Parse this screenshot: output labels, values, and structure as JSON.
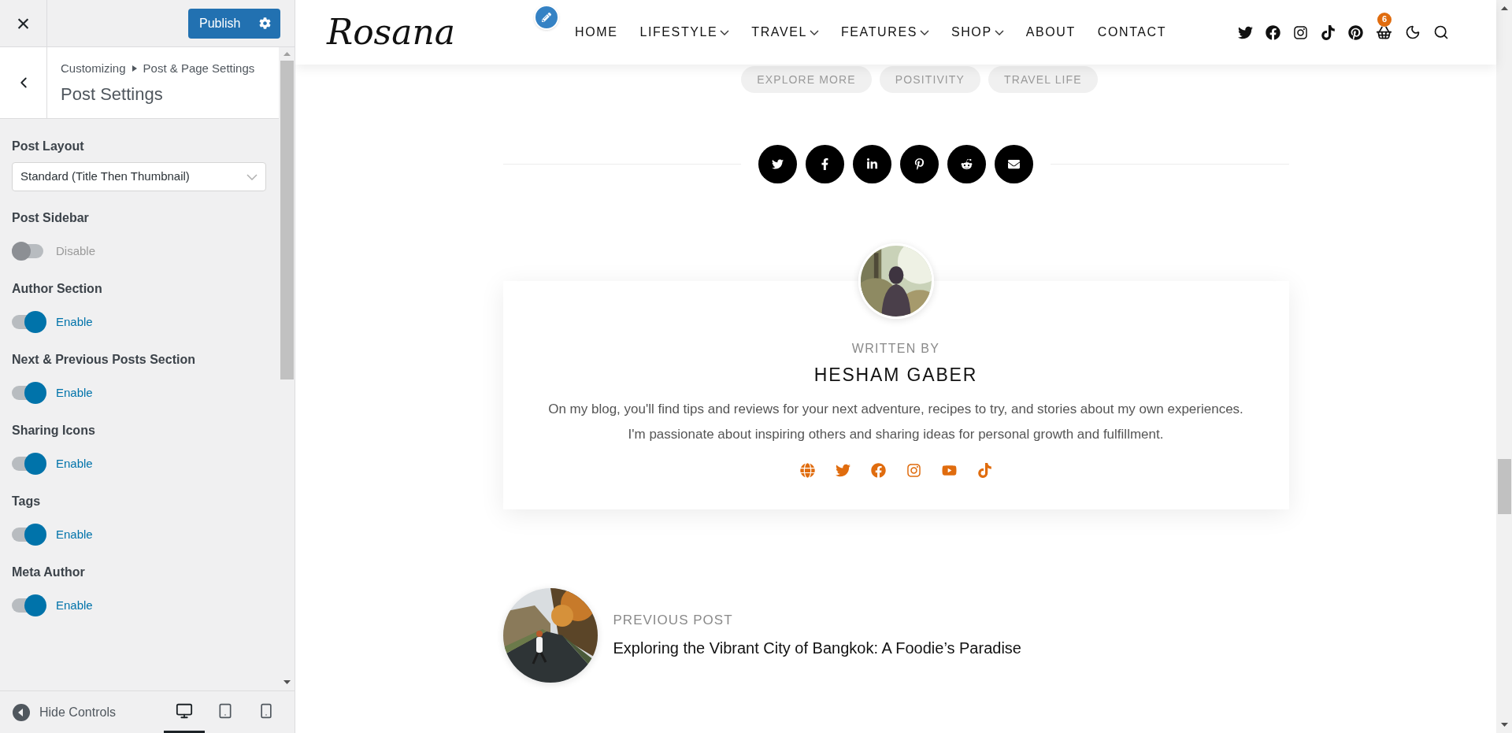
{
  "customizer": {
    "close": "×",
    "publish": "Publish",
    "breadcrumb": [
      "Customizing",
      "Post & Page Settings"
    ],
    "section_title": "Post Settings",
    "controls": [
      {
        "kind": "select",
        "label": "Post Layout",
        "value": "Standard (Title Then Thumbnail)"
      },
      {
        "kind": "toggle",
        "label": "Post Sidebar",
        "on": false,
        "state_label": "Disable"
      },
      {
        "kind": "toggle",
        "label": "Author Section",
        "on": true,
        "state_label": "Enable"
      },
      {
        "kind": "toggle",
        "label": "Next & Previous Posts Section",
        "on": true,
        "state_label": "Enable"
      },
      {
        "kind": "toggle",
        "label": "Sharing Icons",
        "on": true,
        "state_label": "Enable"
      },
      {
        "kind": "toggle",
        "label": "Tags",
        "on": true,
        "state_label": "Enable"
      },
      {
        "kind": "toggle",
        "label": "Meta Author",
        "on": true,
        "state_label": "Enable"
      }
    ],
    "footer": {
      "hide_controls": "Hide Controls",
      "devices": [
        {
          "kind": "desktop",
          "selected": true
        },
        {
          "kind": "tablet",
          "selected": false
        },
        {
          "kind": "mobile",
          "selected": false
        }
      ]
    }
  },
  "site": {
    "logo": "Rosana",
    "nav": [
      {
        "label": "HOME",
        "dropdown": false
      },
      {
        "label": "LIFESTYLE",
        "dropdown": true
      },
      {
        "label": "TRAVEL",
        "dropdown": true
      },
      {
        "label": "FEATURES",
        "dropdown": true
      },
      {
        "label": "SHOP",
        "dropdown": true
      },
      {
        "label": "ABOUT",
        "dropdown": false
      },
      {
        "label": "CONTACT",
        "dropdown": false
      }
    ],
    "cart_badge": "6",
    "tags": [
      "EXPLORE MORE",
      "POSITIVITY",
      "TRAVEL LIFE"
    ],
    "author": {
      "written_by": "WRITTEN BY",
      "name": "HESHAM GABER",
      "bio": "On my blog, you'll find tips and reviews for your next adventure, recipes to try, and stories about my own experiences. I'm passionate about inspiring others and sharing ideas for personal growth and fulfillment."
    },
    "previous_post": {
      "label": "PREVIOUS POST",
      "title": "Exploring the Vibrant City of Bangkok: A Foodie’s Paradise"
    }
  }
}
